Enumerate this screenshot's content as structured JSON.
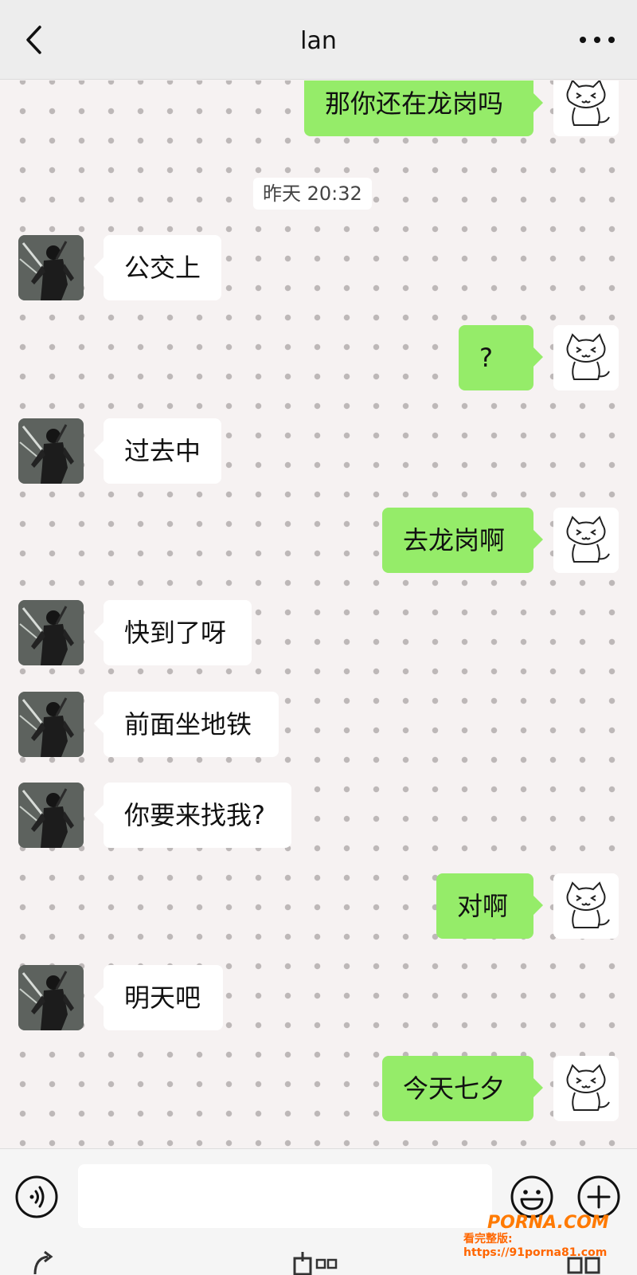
{
  "header": {
    "title": "lan",
    "back_icon": "chevron-left-icon",
    "more_icon": "more-dots-icon"
  },
  "chat": {
    "timestamp": "昨天 20:32",
    "messages": [
      {
        "side": "right",
        "text": "那你还在龙岗吗"
      },
      {
        "side": "left",
        "text": "公交上"
      },
      {
        "side": "right",
        "text": "?"
      },
      {
        "side": "left",
        "text": "过去中"
      },
      {
        "side": "right",
        "text": "去龙岗啊"
      },
      {
        "side": "left",
        "text": "快到了呀"
      },
      {
        "side": "left",
        "text": "前面坐地铁"
      },
      {
        "side": "left",
        "text": "你要来找我?"
      },
      {
        "side": "right",
        "text": "对啊"
      },
      {
        "side": "left",
        "text": "明天吧"
      },
      {
        "side": "right",
        "text": "今天七夕"
      }
    ],
    "colors": {
      "sent_bubble": "#95ec69",
      "received_bubble": "#ffffff",
      "background": "#f6f2f2"
    }
  },
  "input_bar": {
    "placeholder": "",
    "voice_icon": "voice-icon",
    "emoji_icon": "emoji-icon",
    "plus_icon": "plus-icon"
  },
  "watermark": {
    "logo": "PORNA.COM",
    "url": "看完整版: https://91porna81.com"
  }
}
